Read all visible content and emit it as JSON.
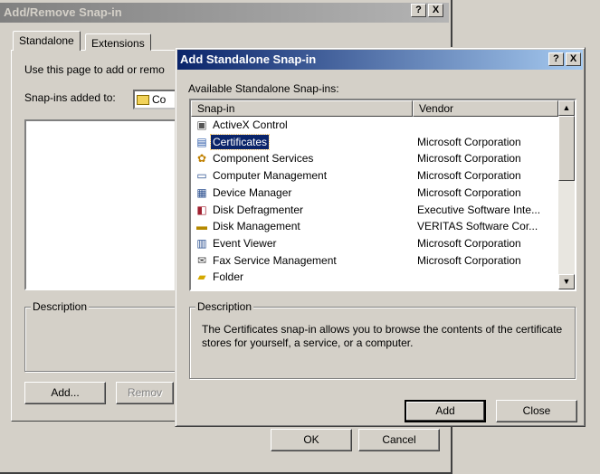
{
  "back_window": {
    "title": "Add/Remove Snap-in",
    "help_button": "?",
    "close_button": "X",
    "tabs": [
      {
        "label": "Standalone"
      },
      {
        "label": "Extensions"
      }
    ],
    "intro_text": "Use this page to add or remo",
    "snapins_added_label": "Snap-ins added to:",
    "snapins_added_value": "Co",
    "description_label": "Description",
    "add_button": "Add...",
    "remove_button": "Remov",
    "ok_button": "OK",
    "cancel_button": "Cancel"
  },
  "front_window": {
    "title": "Add Standalone Snap-in",
    "help_button": "?",
    "close_button": "X",
    "available_label": "Available Standalone Snap-ins:",
    "columns": [
      "Snap-in",
      "Vendor"
    ],
    "rows": [
      {
        "name": "ActiveX Control",
        "vendor": "",
        "icon": "activex-icon"
      },
      {
        "name": "Certificates",
        "vendor": "Microsoft Corporation",
        "icon": "certificates-icon",
        "selected": true
      },
      {
        "name": "Component Services",
        "vendor": "Microsoft Corporation",
        "icon": "component-services-icon"
      },
      {
        "name": "Computer Management",
        "vendor": "Microsoft Corporation",
        "icon": "computer-management-icon"
      },
      {
        "name": "Device Manager",
        "vendor": "Microsoft Corporation",
        "icon": "device-manager-icon"
      },
      {
        "name": "Disk Defragmenter",
        "vendor": "Executive Software Inte...",
        "icon": "disk-defragmenter-icon"
      },
      {
        "name": "Disk Management",
        "vendor": "VERITAS Software Cor...",
        "icon": "disk-management-icon"
      },
      {
        "name": "Event Viewer",
        "vendor": "Microsoft Corporation",
        "icon": "event-viewer-icon"
      },
      {
        "name": "Fax Service Management",
        "vendor": "Microsoft Corporation",
        "icon": "fax-icon"
      },
      {
        "name": "Folder",
        "vendor": "",
        "icon": "folder-icon"
      }
    ],
    "description_label": "Description",
    "description_text": "The Certificates snap-in allows you to browse the contents of the certificate stores for yourself, a service, or a computer.",
    "add_button": "Add",
    "close_button_label": "Close"
  },
  "colors": {
    "dialog_face": "#d4d0c8",
    "active_title_start": "#0a246a",
    "active_title_end": "#a6caf0",
    "inactive_title": "#808080",
    "selection": "#0a246a"
  }
}
